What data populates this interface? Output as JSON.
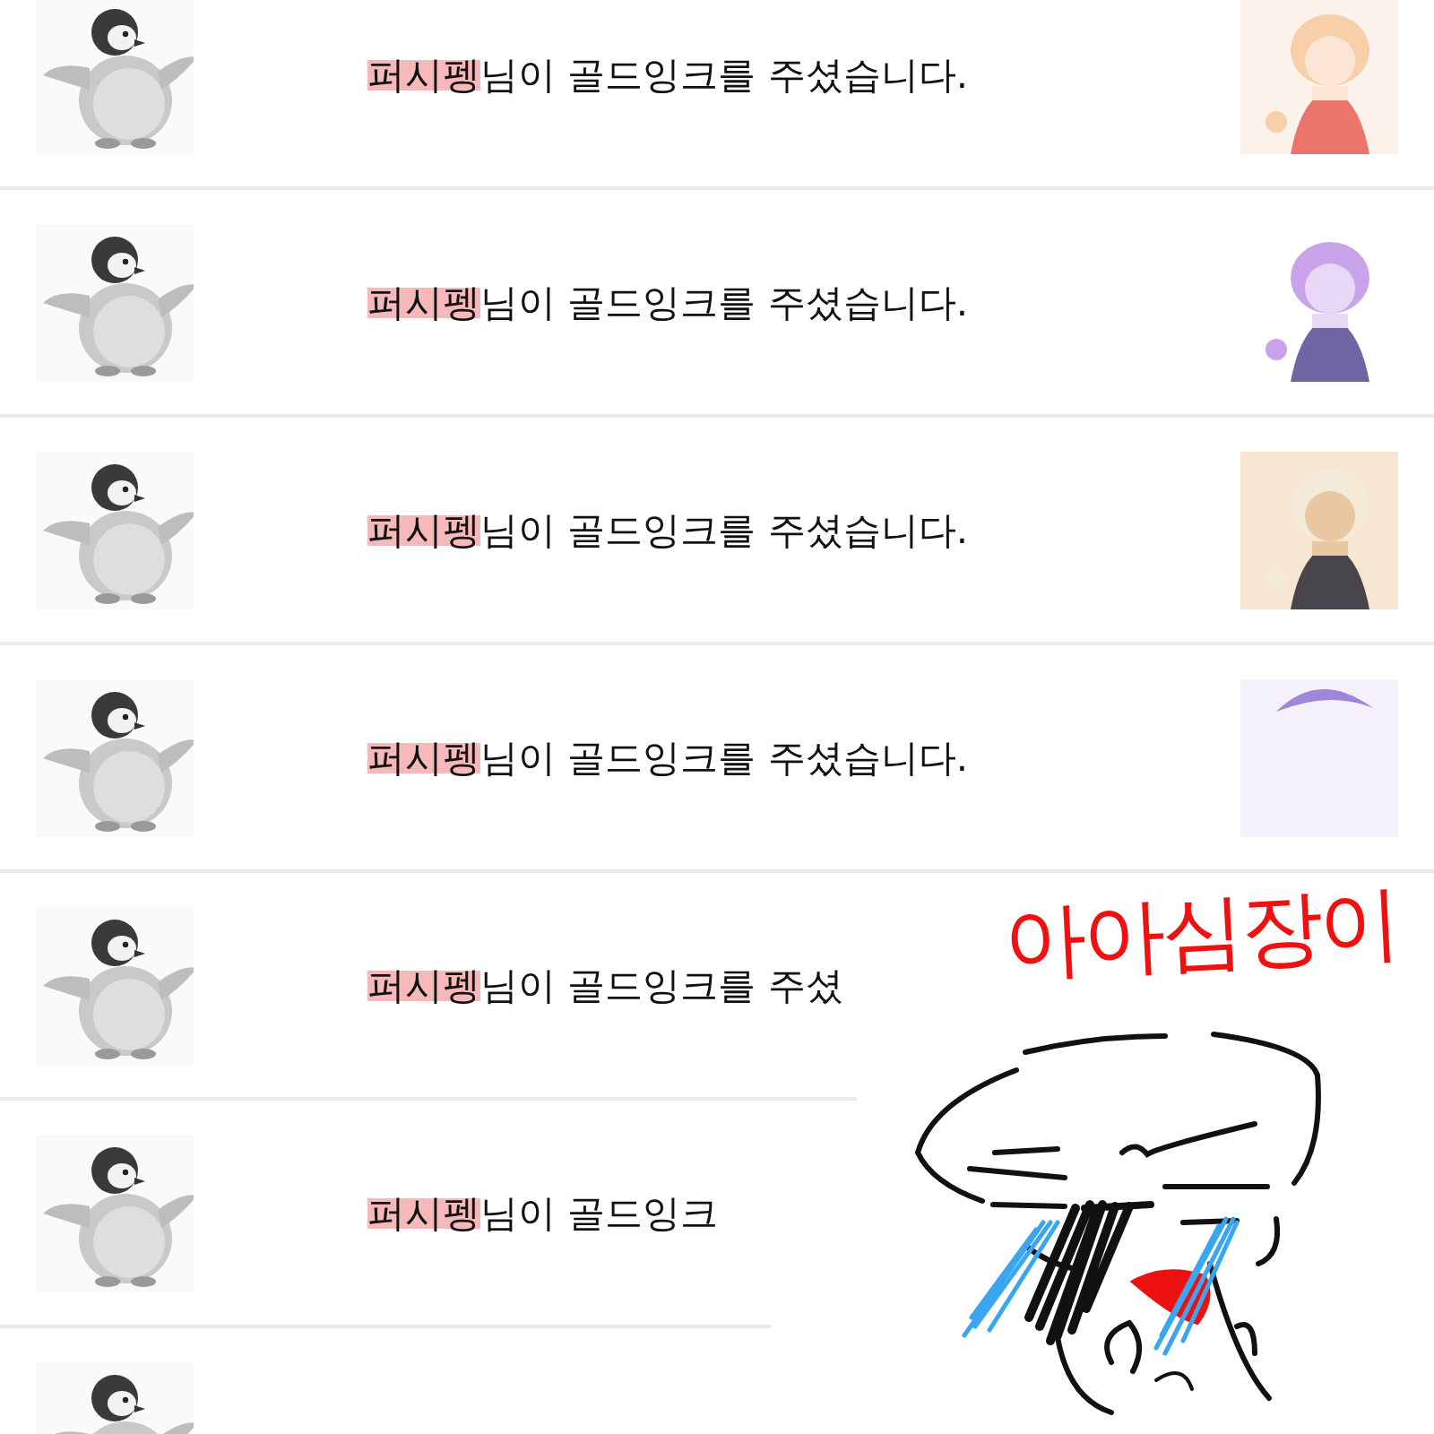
{
  "notifications": [
    {
      "avatar": {
        "kind": "picture"
      },
      "sender": "퍼시펭",
      "message": "님이 골드잉크를 주셨습니다.",
      "thumbnail": {
        "kind": "picture"
      }
    },
    {
      "avatar": {
        "kind": "picture"
      },
      "sender": "퍼시펭",
      "message": "님이 골드잉크를 주셨습니다.",
      "thumbnail": {
        "kind": "picture"
      }
    },
    {
      "avatar": {
        "kind": "picture"
      },
      "sender": "퍼시펭",
      "message": "님이 골드잉크를 주셨습니다.",
      "thumbnail": {
        "kind": "picture"
      }
    },
    {
      "avatar": {
        "kind": "picture"
      },
      "sender": "퍼시펭",
      "message": "님이 골드잉크를 주셨습니다.",
      "thumbnail": {
        "kind": "picture"
      }
    },
    {
      "avatar": {
        "kind": "picture"
      },
      "sender": "퍼시펭",
      "message": "님이 골드잉크를 주셨"
    },
    {
      "avatar": {
        "kind": "picture"
      },
      "sender": "퍼시펭",
      "message": "님이 골드잉크"
    },
    {
      "avatar": {
        "kind": "picture"
      }
    }
  ],
  "doodle": {
    "caption": "아아심장이"
  }
}
